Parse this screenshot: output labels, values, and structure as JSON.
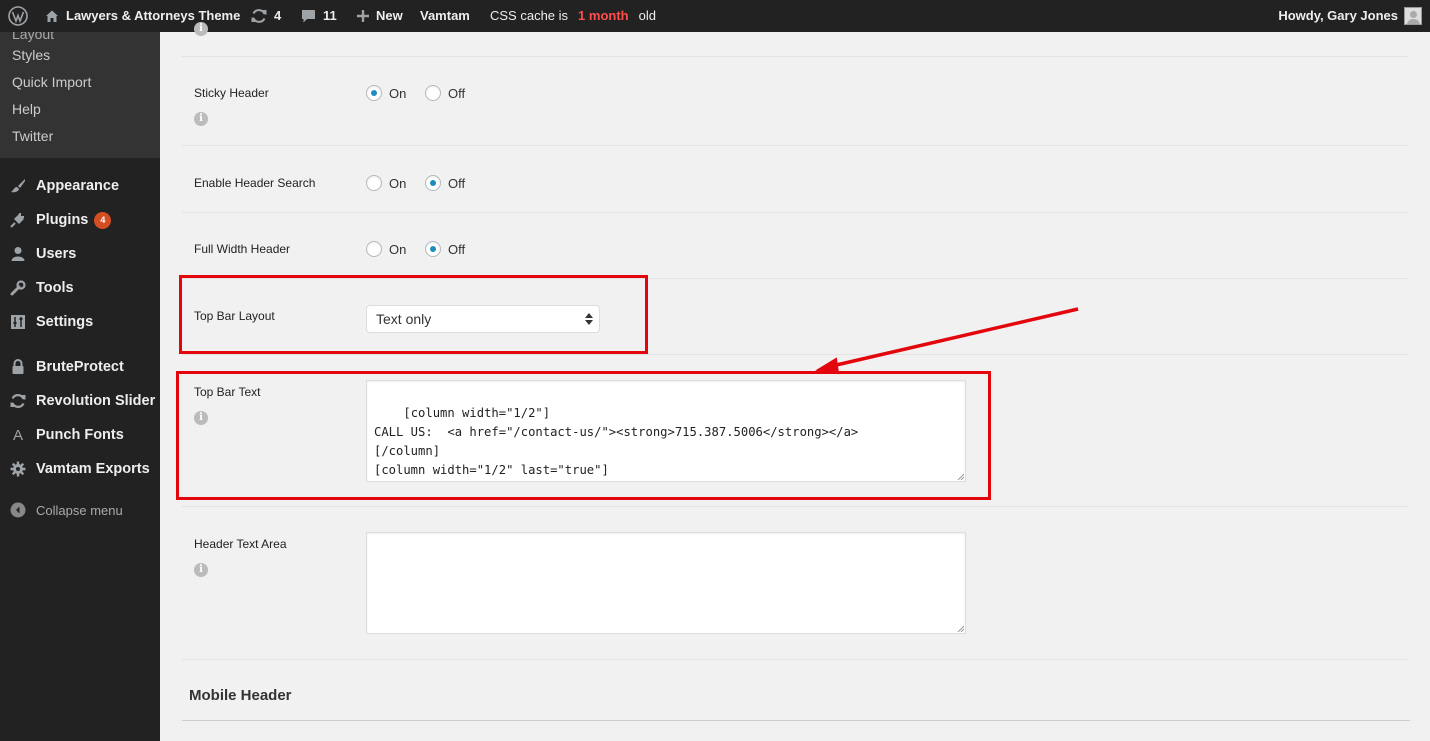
{
  "adminbar": {
    "site_name": "Lawyers & Attorneys Theme",
    "updates_count": "4",
    "comments_count": "11",
    "new_label": "New",
    "vamtam_label": "Vamtam",
    "cache_prefix": "CSS cache is",
    "cache_age": "1 month",
    "cache_suffix": "old",
    "howdy": "Howdy, Gary Jones"
  },
  "sidebar": {
    "submenu": [
      "Styles",
      "Quick Import",
      "Help",
      "Twitter"
    ],
    "items": [
      {
        "label": "Appearance",
        "icon": "paintbrush-icon"
      },
      {
        "label": "Plugins",
        "icon": "plugin-icon",
        "badge": "4"
      },
      {
        "label": "Users",
        "icon": "users-icon"
      },
      {
        "label": "Tools",
        "icon": "wrench-icon"
      },
      {
        "label": "Settings",
        "icon": "settings-icon"
      },
      {
        "label": "BruteProtect",
        "icon": "lock-icon"
      },
      {
        "label": "Revolution Slider",
        "icon": "refresh-icon"
      },
      {
        "label": "Punch Fonts",
        "icon": "font-icon"
      },
      {
        "label": "Vamtam Exports",
        "icon": "gear-icon"
      }
    ],
    "collapse_label": "Collapse menu"
  },
  "options": {
    "sticky_header": {
      "label": "Sticky Header",
      "on": "On",
      "off": "Off",
      "selected": "On"
    },
    "header_search": {
      "label": "Enable Header Search",
      "on": "On",
      "off": "Off",
      "selected": "Off"
    },
    "full_width_header": {
      "label": "Full Width Header",
      "on": "On",
      "off": "Off",
      "selected": "Off"
    },
    "top_bar_layout": {
      "label": "Top Bar Layout",
      "value": "Text only"
    },
    "top_bar_text": {
      "label": "Top Bar Text",
      "value": "[column width=\"1/2\"]\nCALL US:  <a href=\"/contact-us/\"><strong>715.387.5006</strong></a>\n[/column]\n[column width=\"1/2\" last=\"true\"]\n<div class=\"text-align: right\"><span style=\"vertical-align: top;\"><a"
    },
    "header_text_area": {
      "label": "Header Text Area",
      "value": ""
    }
  },
  "section": {
    "mobile_header": "Mobile Header"
  },
  "colors": {
    "annotation": "#e3060d",
    "radio_checked": "#1e8cbe",
    "badge": "#d54e21"
  }
}
